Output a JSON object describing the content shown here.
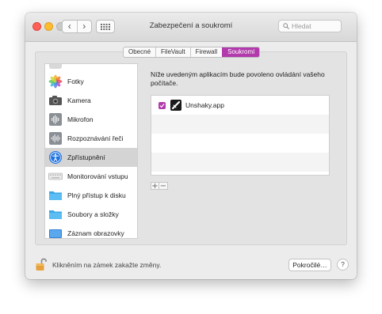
{
  "window": {
    "title": "Zabezpečení a soukromí",
    "nav_back": "‹",
    "nav_forward": "›"
  },
  "search": {
    "placeholder": "Hledat"
  },
  "tabs": [
    {
      "label": "Obecné",
      "active": false
    },
    {
      "label": "FileVault",
      "active": false
    },
    {
      "label": "Firewall",
      "active": false
    },
    {
      "label": "Soukromí",
      "active": true
    }
  ],
  "sidebar": {
    "items": [
      {
        "label": "Fotky",
        "icon": "photos-icon"
      },
      {
        "label": "Kamera",
        "icon": "camera-icon"
      },
      {
        "label": "Mikrofon",
        "icon": "microphone-icon"
      },
      {
        "label": "Rozpoznávání řeči",
        "icon": "speech-recognition-icon"
      },
      {
        "label": "Zpřístupnění",
        "icon": "accessibility-icon",
        "selected": true
      },
      {
        "label": "Monitorování vstupu",
        "icon": "keyboard-icon"
      },
      {
        "label": "Plný přístup k disku",
        "icon": "folder-icon"
      },
      {
        "label": "Soubory a složky",
        "icon": "folder-icon"
      },
      {
        "label": "Záznam obrazovky",
        "icon": "screen-recording-icon"
      }
    ]
  },
  "main": {
    "description": "Níže uvedeným aplikacím bude povoleno ovládání vašeho počítače.",
    "apps": [
      {
        "name": "Unshaky.app",
        "checked": true
      }
    ],
    "add_label": "+",
    "remove_label": "−"
  },
  "footer": {
    "lock_text": "Klikněním na zámek zakažte změny.",
    "advanced_label": "Pokročilé…",
    "help_label": "?"
  },
  "colors": {
    "accent": "#b23aac",
    "close": "#fe5f57",
    "minimize": "#febc2e",
    "lock": "#e6a03c"
  }
}
